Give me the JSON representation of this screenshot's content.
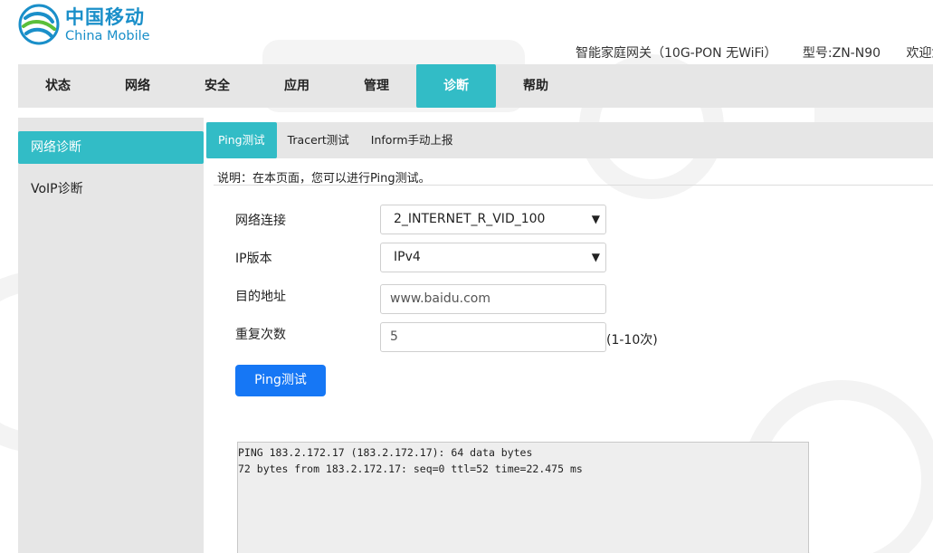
{
  "brand": {
    "cn": "中国移动",
    "en": "China Mobile"
  },
  "device": {
    "name": "智能家庭网关（10G-PON 无WiFi）",
    "model": "型号:ZN-N90",
    "welcome": "欢迎您,"
  },
  "topnav": [
    {
      "label": "状态"
    },
    {
      "label": "网络"
    },
    {
      "label": "安全"
    },
    {
      "label": "应用"
    },
    {
      "label": "管理"
    },
    {
      "label": "诊断"
    },
    {
      "label": "帮助"
    }
  ],
  "sidebar": [
    {
      "label": "网络诊断"
    },
    {
      "label": "VoIP诊断"
    }
  ],
  "subtabs": [
    {
      "label": "Ping测试"
    },
    {
      "label": "Tracert测试"
    },
    {
      "label": "Inform手动上报"
    }
  ],
  "description": "说明：在本页面，您可以进行Ping测试。",
  "form": {
    "connection": {
      "label": "网络连接",
      "value": "2_INTERNET_R_VID_100"
    },
    "ip_version": {
      "label": "IP版本",
      "value": "IPv4"
    },
    "target": {
      "label": "目的地址",
      "value": "www.baidu.com"
    },
    "repeat": {
      "label": "重复次数",
      "value": "5",
      "hint": "(1-10次)"
    }
  },
  "ping_button": "Ping测试",
  "output": {
    "lines": [
      "PING 183.2.172.17 (183.2.172.17): 64 data bytes",
      "72 bytes from 183.2.172.17: seq=0 ttl=52 time=22.475 ms"
    ]
  },
  "colors": {
    "accent": "#32bcc6",
    "button": "#1677f5",
    "nav_bg": "#e6e6e6",
    "brand": "#1a8fc9"
  }
}
